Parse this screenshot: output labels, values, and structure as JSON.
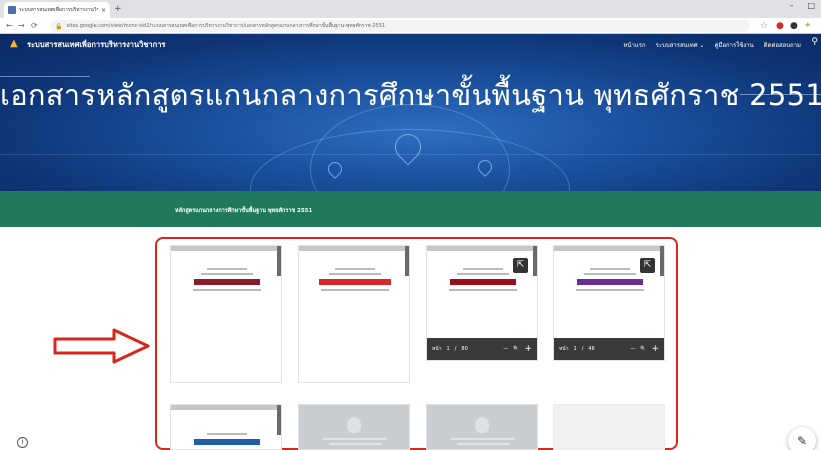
{
  "browser": {
    "tab_title": "ระบบสารสนเทศเพื่อการบริหารงานวิชาการ",
    "tab_close": "×",
    "new_tab": "+",
    "url": "sites.google.com/view/mcnc-sid2/ระบบสารสนเทศเพื่อการบริหารงานวิชาการ/เอกสารหลักสูตรแกนกลางการศึกษาขั้นพื้นฐาน-พุทธศักราช-2551",
    "window_controls": [
      "–",
      "□",
      "×"
    ]
  },
  "site": {
    "name": "ระบบสารสนเทศเพื่อการบริหารงานวิชาการ",
    "nav": [
      {
        "label": "หน้าแรก"
      },
      {
        "label": "ระบบสารสนเทศ ⌄"
      },
      {
        "label": "คู่มือการใช้งาน"
      },
      {
        "label": "ติดต่อสอบถาม"
      }
    ],
    "hero_title": "เอกสารหลักสูตรแกนกลางการศึกษาขั้นพื้นฐาน พุทธศักราช 2551",
    "breadcrumb": "หลักสูตรแกนกลางการศึกษาขั้นพื้นฐาน พุทธศักราช 2551"
  },
  "documents": [
    {
      "band_color": "#8b1a2b",
      "has_viewer": false
    },
    {
      "band_color": "#d62828",
      "has_viewer": false
    },
    {
      "band_color": "#9b0f1a",
      "has_viewer": true,
      "page_label": "หน้า",
      "page_current": "1",
      "page_total": "80"
    },
    {
      "band_color": "#6a2c91",
      "has_viewer": true,
      "page_label": "หน้า",
      "page_current": "1",
      "page_total": "46"
    },
    {
      "band_color": "#1f5fa8",
      "has_viewer": false
    },
    {
      "faded": true
    },
    {
      "faded": true
    },
    {
      "empty": true
    }
  ],
  "viewer_controls": {
    "zoom_out": "—",
    "zoom": "🔍",
    "zoom_in": "+",
    "separator": "/"
  },
  "colors": {
    "header_blue": "#1a4f9c",
    "green_bar": "#1f7a5c",
    "highlight_red": "#d9261c"
  }
}
